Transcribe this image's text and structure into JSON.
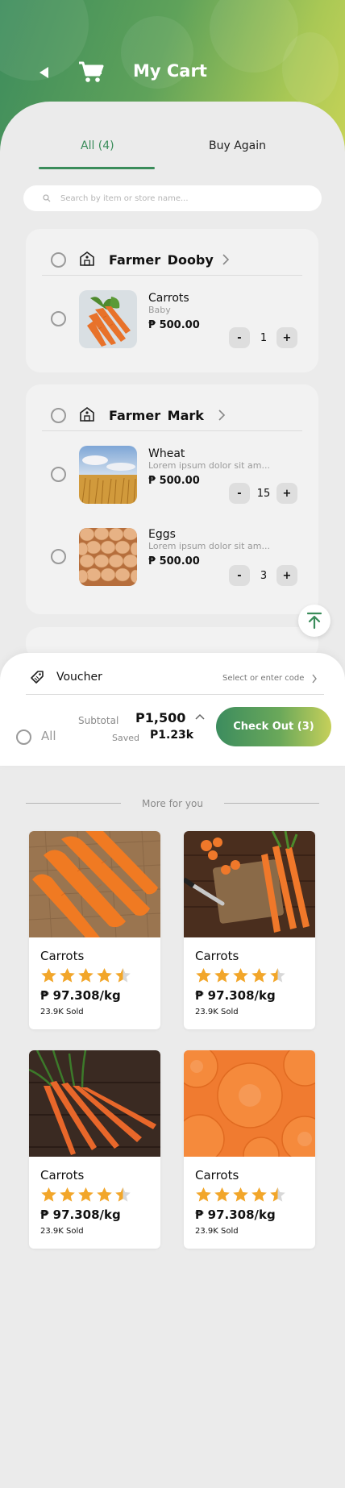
{
  "header": {
    "title": "My Cart",
    "back_icon": "back-arrow-icon",
    "cart_icon": "shopping-cart-icon",
    "gradient": [
      "#3d8c5c",
      "#c8d357"
    ]
  },
  "tabs": [
    {
      "label": "All (4)",
      "active": true
    },
    {
      "label": "Buy Again",
      "active": false
    }
  ],
  "search": {
    "placeholder": "Search by item or store name..."
  },
  "stores": [
    {
      "name": "Farmer  Dooby",
      "items": [
        {
          "name": "Carrots",
          "subtitle": "Baby",
          "price": "₱ 500.00",
          "qty": "1"
        }
      ]
    },
    {
      "name": "Farmer  Mark",
      "items": [
        {
          "name": "Wheat",
          "subtitle": "Lorem ipsum dolor sit am...",
          "price": "₱ 500.00",
          "qty": "15"
        },
        {
          "name": "Eggs",
          "subtitle": "Lorem ipsum dolor sit am...",
          "price": "₱ 500.00",
          "qty": "3"
        }
      ]
    }
  ],
  "qty_controls": {
    "minus": "-",
    "plus": "+"
  },
  "voucher": {
    "label": "Voucher",
    "action": "Select or enter code"
  },
  "summary": {
    "all_label": "All",
    "subtotal_label": "Subtotal",
    "subtotal_value": "P1,500",
    "saved_label": "Saved",
    "saved_value": "P1.23k",
    "checkout_label": "Check Out (3)"
  },
  "more": {
    "heading": "More for you",
    "products": [
      {
        "name": "Carrots",
        "price": "₱ 97.308/kg",
        "sold": "23.9K Sold",
        "rating": 4.5
      },
      {
        "name": "Carrots",
        "price": "₱ 97.308/kg",
        "sold": "23.9K Sold",
        "rating": 4.5
      },
      {
        "name": "Carrots",
        "price": "₱ 97.308/kg",
        "sold": "23.9K Sold",
        "rating": 4.5
      },
      {
        "name": "Carrots",
        "price": "₱ 97.308/kg",
        "sold": "23.9K Sold",
        "rating": 4.5
      }
    ]
  },
  "colors": {
    "accent": "#3a8c5a",
    "star": "#f2a62a"
  }
}
